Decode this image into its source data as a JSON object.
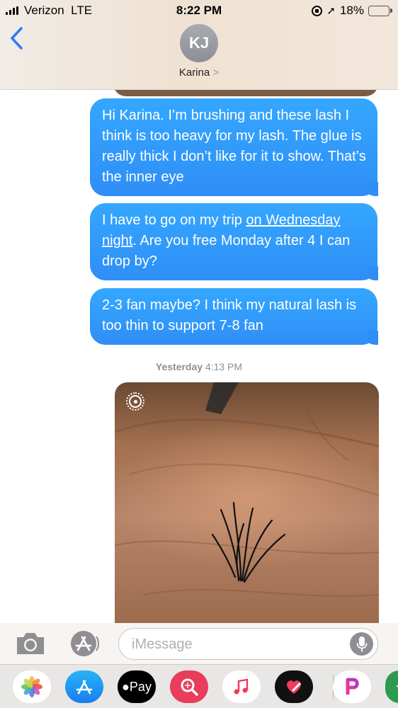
{
  "status_bar": {
    "carrier": "Verizon",
    "network": "LTE",
    "time": "8:22 PM",
    "battery_percent": "18%",
    "battery_level": 0.18,
    "battery_color": "#ff3b30"
  },
  "nav": {
    "back_icon": "chevron-left-icon",
    "avatar_initials": "KJ",
    "contact_name": "Karina",
    "contact_chevron": ">"
  },
  "messages": [
    {
      "text": "Hi Karina. I’m brushing and these lash I think is too heavy for my lash. The glue is really thick I don’t like for it to show. That’s the inner eye"
    },
    {
      "text_before": "I have to go on my trip ",
      "link": "on Wednesday night",
      "text_after": ". Are you free Monday after 4 I can drop by?"
    },
    {
      "text": "2-3 fan maybe? I think my natural lash is too thin to support 7-8 fan"
    }
  ],
  "timestamp": {
    "day": "Yesterday",
    "time": "4:13 PM"
  },
  "input": {
    "placeholder": "iMessage"
  },
  "app_drawer": [
    "photos-icon",
    "app-store-icon",
    "apple-pay-icon",
    "search-images-icon",
    "music-icon",
    "heart-sticker-icon",
    "p-app-icon",
    "partial-app-icon"
  ],
  "apple_pay_label": "Pay",
  "colors": {
    "bubble_blue": "#2f8ef6",
    "ios_blue": "#2f7cf6"
  }
}
